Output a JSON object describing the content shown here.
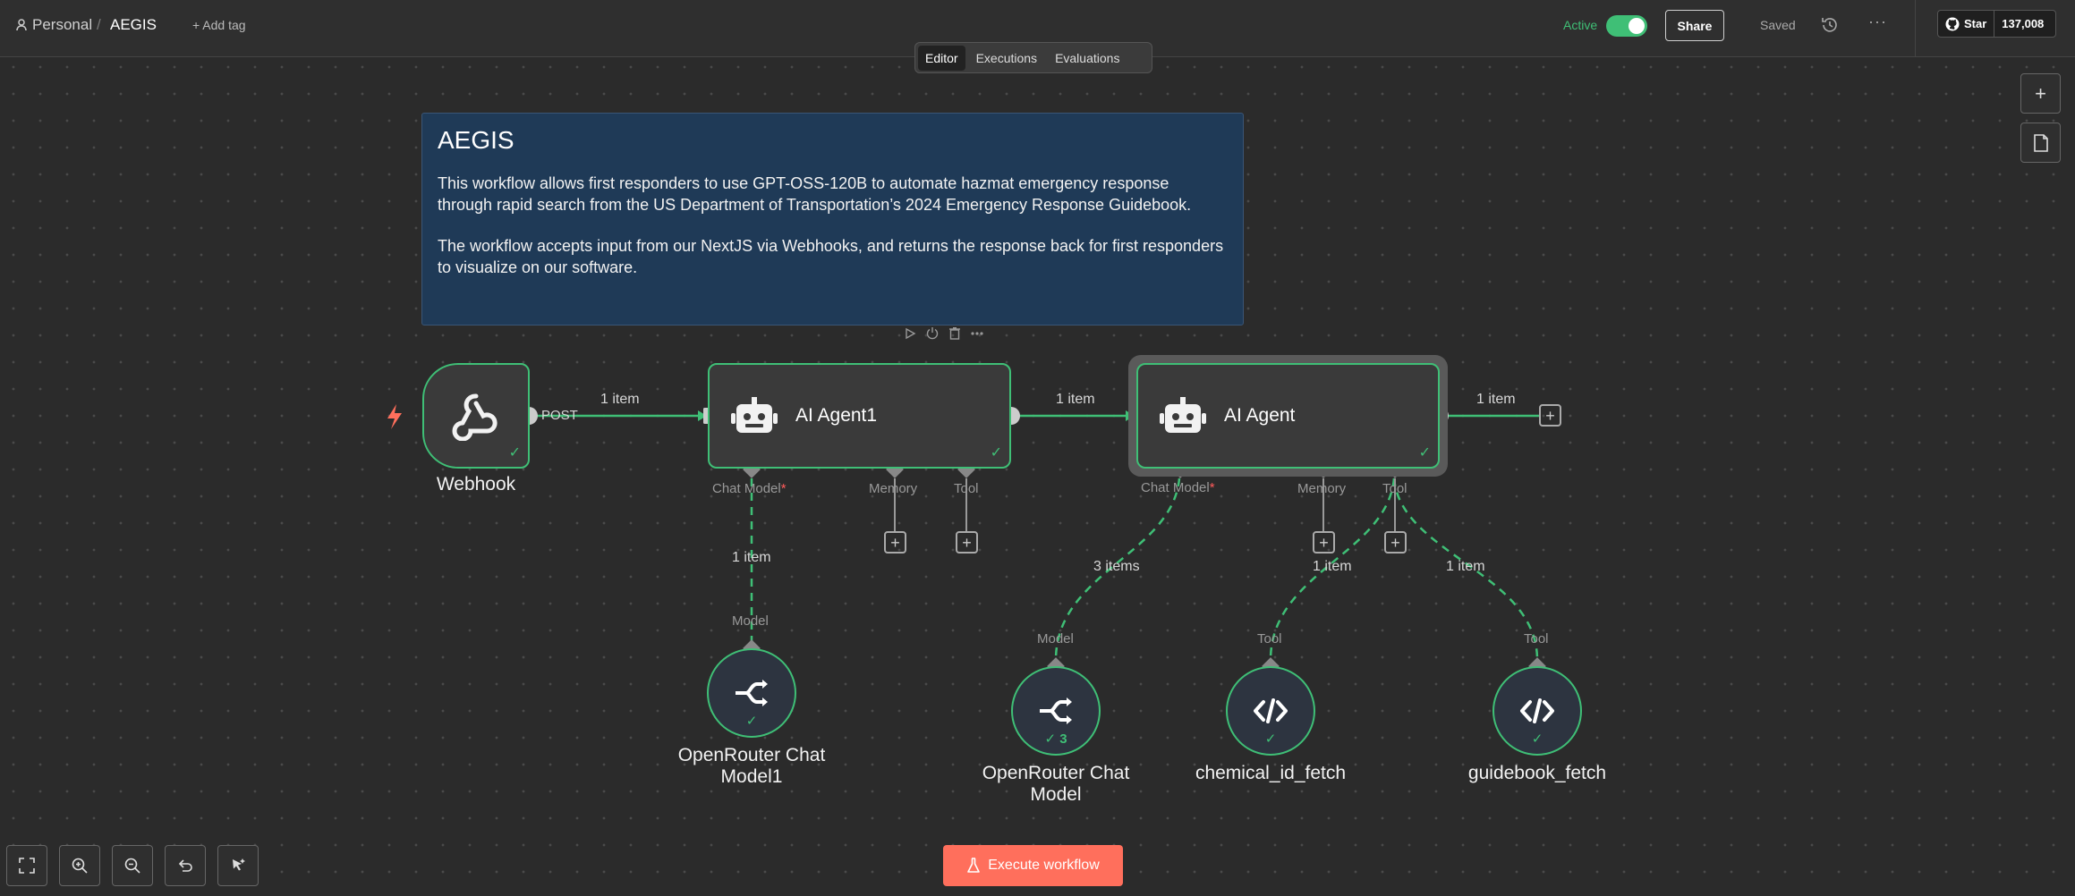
{
  "header": {
    "project": "Personal",
    "separator": "/",
    "workflow_title": "AEGIS",
    "add_tag": "+ Add tag",
    "active_label": "Active",
    "share": "Share",
    "saved": "Saved",
    "more": "···",
    "github_star": "Star",
    "github_count": "137,008"
  },
  "tabs": [
    {
      "label": "Editor",
      "active": true
    },
    {
      "label": "Executions",
      "active": false
    },
    {
      "label": "Evaluations",
      "active": false
    }
  ],
  "sticky_note": {
    "title": "AEGIS",
    "paragraph1": "This workflow allows first responders to use GPT-OSS-120B to automate hazmat emergency response through rapid search from the US Department of Transportation’s 2024 Emergency Response Guidebook.",
    "paragraph2": "The workflow accepts input from our NextJS via Webhooks, and returns the response back for first responders to visualize on our software."
  },
  "nodes": {
    "webhook": {
      "title": "Webhook",
      "output_label": "POST"
    },
    "agent1": {
      "title": "AI Agent1",
      "ports": [
        "Chat Model",
        "Memory",
        "Tool"
      ]
    },
    "agent2": {
      "title": "AI Agent",
      "ports": [
        "Chat Model",
        "Memory",
        "Tool"
      ]
    },
    "openrouter1": {
      "title_line1": "OpenRouter Chat",
      "title_line2": "Model1",
      "port": "Model"
    },
    "openrouter2": {
      "title_line1": "OpenRouter Chat",
      "title_line2": "Model",
      "port": "Model",
      "run_count": "3"
    },
    "chemical": {
      "title": "chemical_id_fetch",
      "port": "Tool"
    },
    "guidebook": {
      "title": "guidebook_fetch",
      "port": "Tool"
    }
  },
  "connections": {
    "webhook_to_agent1": "1 item",
    "agent1_to_agent2": "1 item",
    "agent2_out": "1 item",
    "model1": "1 item",
    "model2": "3 items",
    "chem_tool": "1 item",
    "guide_tool": "1 item"
  },
  "required_marker": "*",
  "execute_button": "Execute workflow",
  "colors": {
    "success": "#3fbf76",
    "execute": "#ff6f5c",
    "sticky": "#1f3a57"
  }
}
